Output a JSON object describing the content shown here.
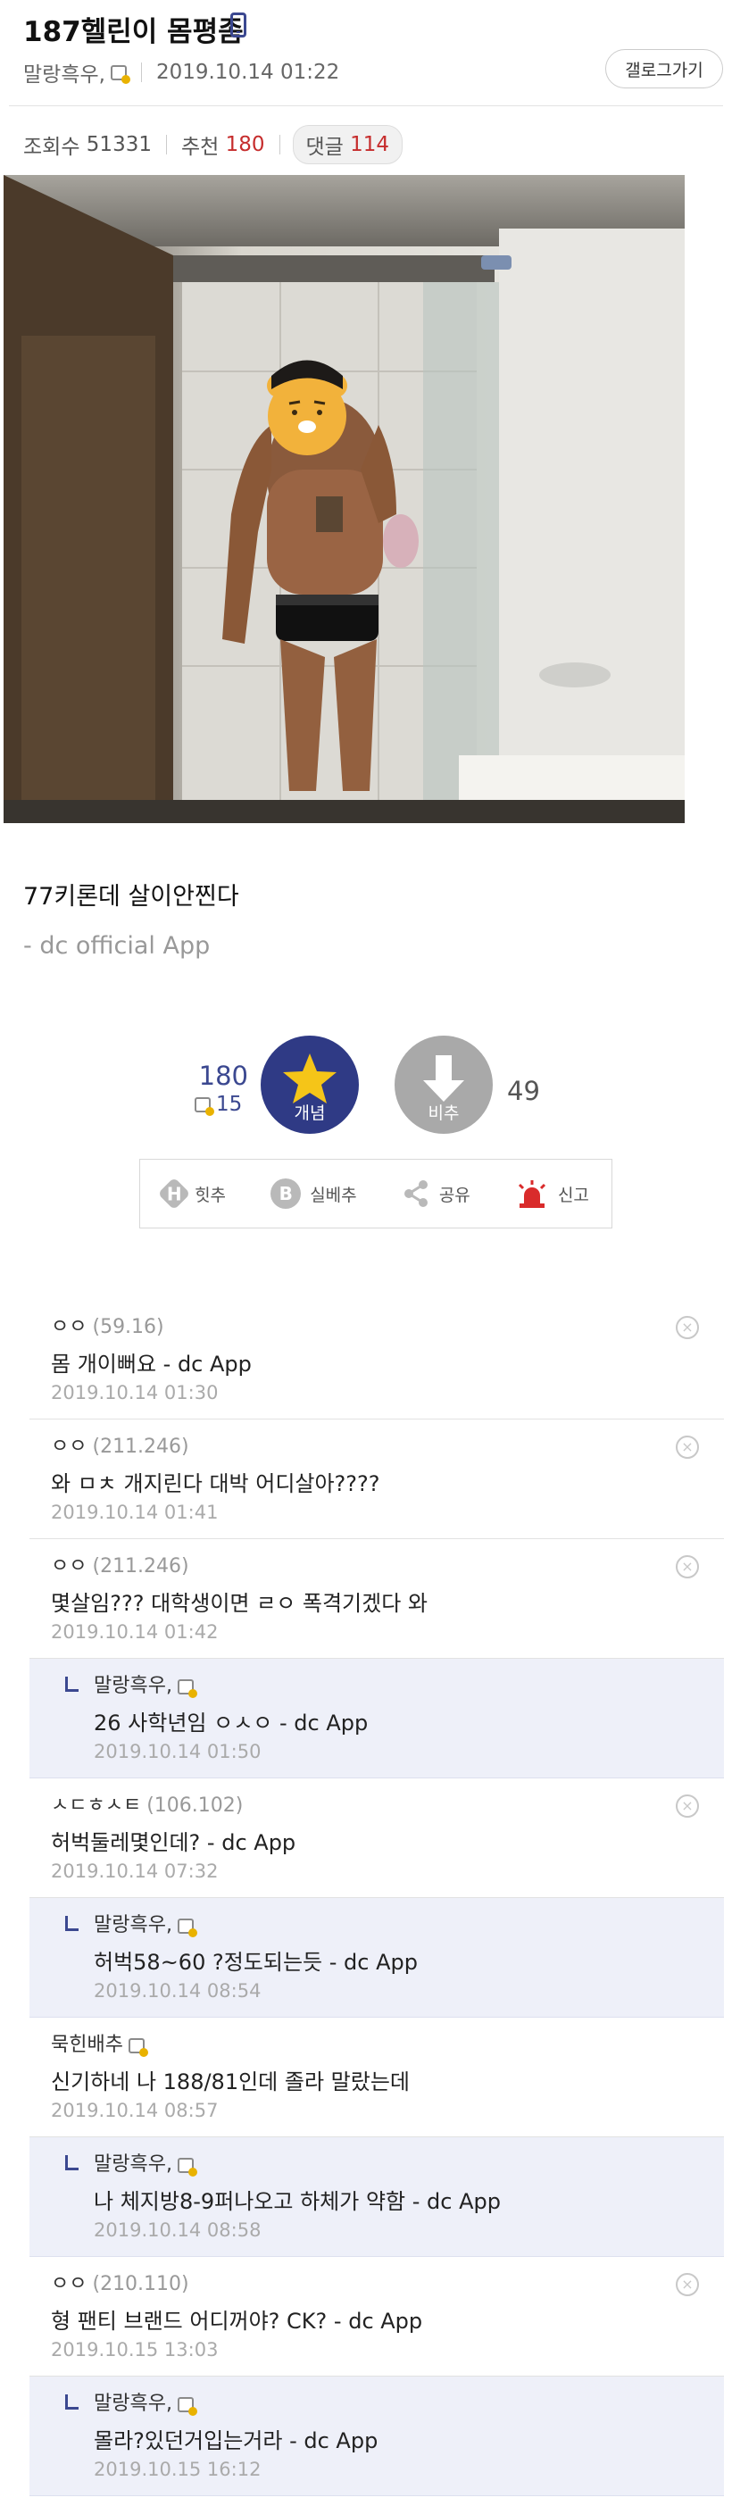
{
  "post": {
    "title": "187헬린이 몸평좀",
    "author": "말랑흑우,",
    "datetime": "2019.10.14 01:22",
    "gallery_button": "갤로그가기",
    "views_label": "조회수",
    "views": "51331",
    "recommend_label": "추천",
    "recommend": "180",
    "comments_label": "댓글",
    "comments_count": "114",
    "body": "77키론데 살이안찐다",
    "signature": "- dc official App"
  },
  "vote": {
    "up_count": "180",
    "fixed_up_count": "15",
    "up_label": "개념",
    "down_label": "비추",
    "down_count": "49"
  },
  "actions": [
    {
      "icon": "H",
      "label": "힛추"
    },
    {
      "icon": "B",
      "label": "실베추"
    },
    {
      "icon": "share",
      "label": "공유"
    },
    {
      "icon": "siren",
      "label": "신고"
    }
  ],
  "comments": [
    {
      "type": "comment",
      "name": "ㅇㅇ",
      "ip": "(59.16)",
      "text": "몸 개이뻐요 - dc App",
      "date": "2019.10.14 01:30"
    },
    {
      "type": "comment",
      "name": "ㅇㅇ",
      "ip": "(211.246)",
      "text": "와 ㅁㅊ 개지린다 대박 어디살아????",
      "date": "2019.10.14 01:41"
    },
    {
      "type": "comment",
      "name": "ㅇㅇ",
      "ip": "(211.246)",
      "text": "몇살임??? 대학생이면 ㄹㅇ 폭격기겠다 와",
      "date": "2019.10.14 01:42"
    },
    {
      "type": "reply",
      "name": "말랑흑우,",
      "ip": "",
      "text": "26 사학년임 ㅇㅅㅇ - dc App",
      "date": "2019.10.14 01:50"
    },
    {
      "type": "comment",
      "name": "ㅅㄷㅎㅅㅌ",
      "ip": "(106.102)",
      "text": "허벅둘레몇인데? - dc App",
      "date": "2019.10.14 07:32"
    },
    {
      "type": "reply",
      "name": "말랑흑우,",
      "ip": "",
      "text": "허벅58~60 ?정도되는듯 - dc App",
      "date": "2019.10.14 08:54"
    },
    {
      "type": "comment",
      "name": "묵힌배추",
      "ip": "",
      "text": "신기하네 나 188/81인데 졸라 말랐는데",
      "date": "2019.10.14 08:57"
    },
    {
      "type": "reply",
      "name": "말랑흑우,",
      "ip": "",
      "text": "나 체지방8-9퍼나오고 하체가 약함 - dc App",
      "date": "2019.10.14 08:58"
    },
    {
      "type": "comment",
      "name": "ㅇㅇ",
      "ip": "(210.110)",
      "text": "형 팬티 브랜드 어디꺼야? CK? - dc App",
      "date": "2019.10.15 13:03"
    },
    {
      "type": "reply",
      "name": "말랑흑우,",
      "ip": "",
      "text": "몰라?있던거입는거라 - dc App",
      "date": "2019.10.15 16:12"
    }
  ]
}
